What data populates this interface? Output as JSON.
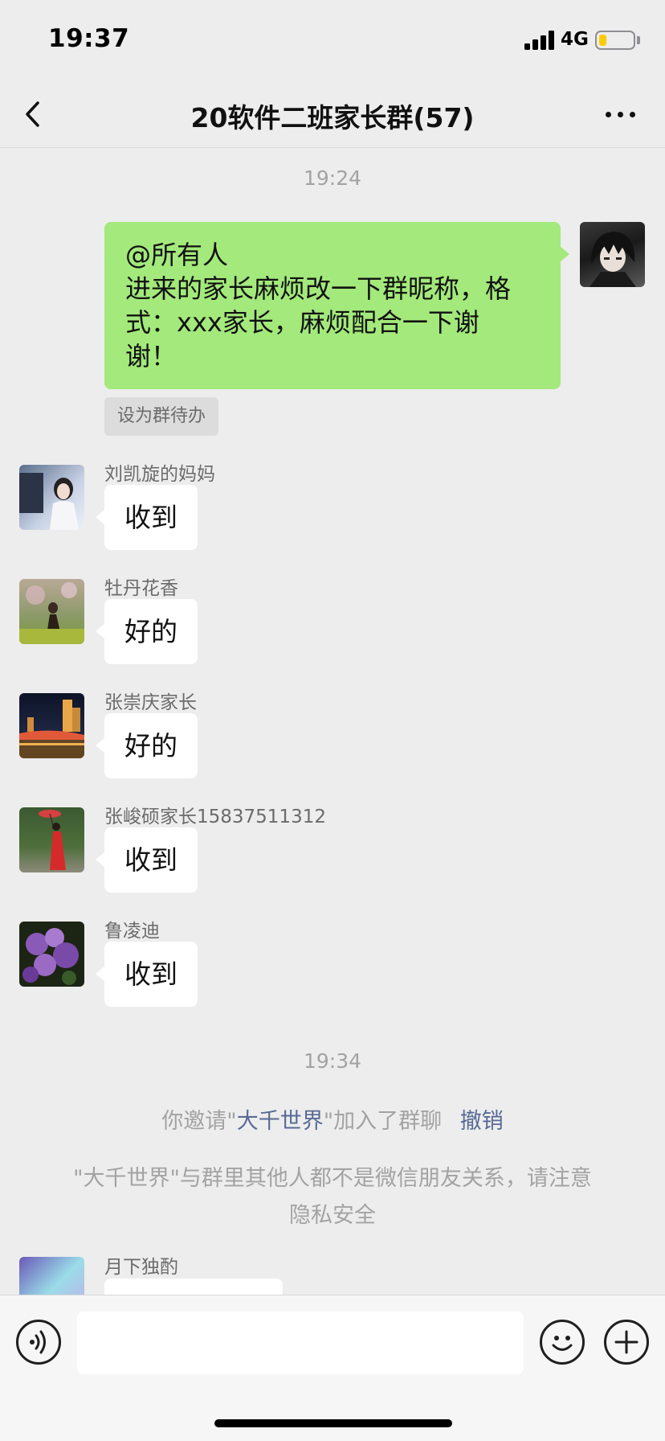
{
  "status_bar": {
    "time": "19:37",
    "network": "4G",
    "battery_level": 0.22
  },
  "nav": {
    "title": "20软件二班家长群(57)",
    "back_icon": "chevron-left-icon",
    "more_icon": "ellipsis-icon"
  },
  "messages": {
    "time1": "19:24",
    "my_message": {
      "line1": "@所有人",
      "line2": "进来的家长麻烦改一下群昵称，格",
      "line3": "式：xxx家长，麻烦配合一下谢",
      "line4": "谢！",
      "todo_label": "设为群待办"
    },
    "incoming": [
      {
        "sender": "刘凯旋的妈妈",
        "text": "收到"
      },
      {
        "sender": "牡丹花香",
        "text": "好的"
      },
      {
        "sender": "张崇庆家长",
        "text": "好的"
      },
      {
        "sender": "张峻硕家长15837511312",
        "text": "收到"
      },
      {
        "sender": "鲁凌迪",
        "text": "收到"
      }
    ],
    "time2": "19:34",
    "invite": {
      "prefix": "你邀请\"",
      "name": "大千世界",
      "suffix": "\"加入了群聊",
      "revoke": "撤销"
    },
    "privacy_notice": {
      "line1": "\"大千世界\"与群里其他人都不是微信朋友关系，请注意",
      "line2": "隐私安全"
    },
    "last_sender": "月下独酌"
  },
  "input_bar": {
    "voice_icon": "voice-icon",
    "emoji_icon": "smiley-icon",
    "plus_icon": "plus-icon"
  },
  "colors": {
    "background": "#ededed",
    "my_bubble": "#a3e97b",
    "link": "#576b95"
  }
}
